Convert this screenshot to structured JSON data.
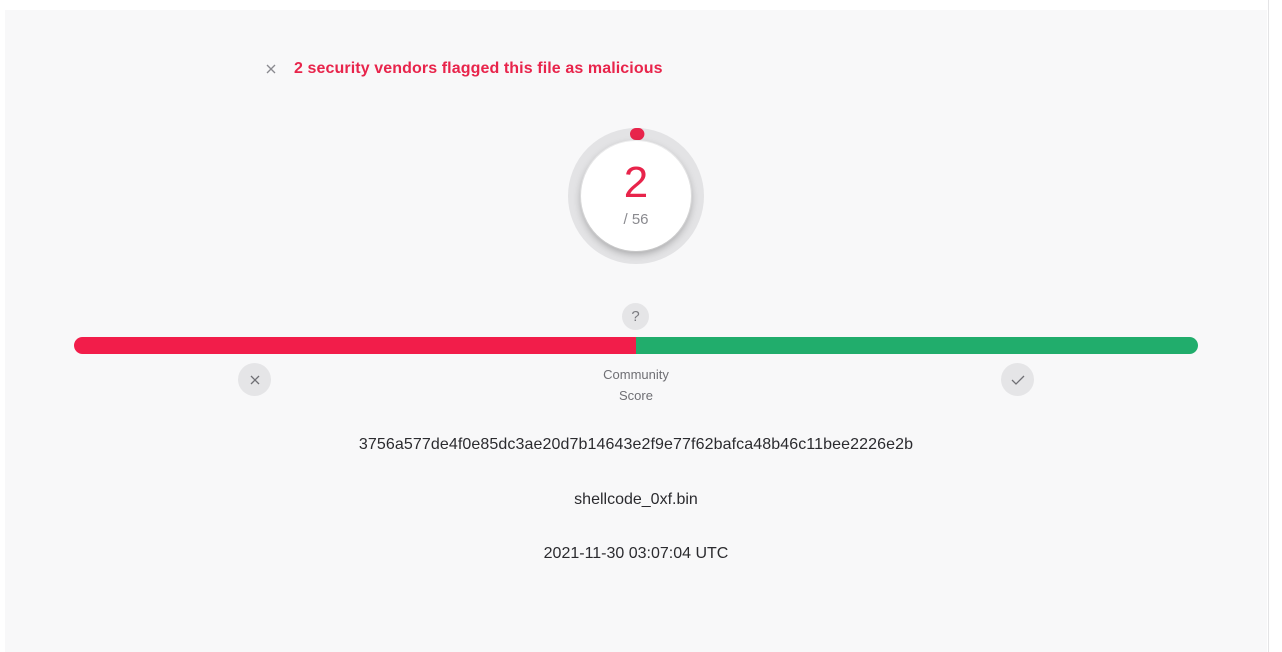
{
  "alert": {
    "icon": "close-icon",
    "text": "2 security vendors flagged this file as malicious",
    "color": "#e8244b"
  },
  "detection": {
    "count": "2",
    "total": "/ 56",
    "detected_fraction": 0.0357,
    "accent_color": "#e8244b"
  },
  "community": {
    "help_icon": "question-icon",
    "help_label": "?",
    "label_line1": "Community",
    "label_line2": "Score",
    "malicious_fraction": 0.5,
    "bad_color": "#f21d4a",
    "good_color": "#21ad6c",
    "vote_down_icon": "close-icon",
    "vote_up_icon": "check-icon"
  },
  "file": {
    "hash": "3756a577de4f0e85dc3ae20d7b14643e2f9e77f62bafca48b46c11bee2226e2b",
    "name": "shellcode_0xf.bin",
    "date": "2021-11-30 03:07:04 UTC"
  }
}
